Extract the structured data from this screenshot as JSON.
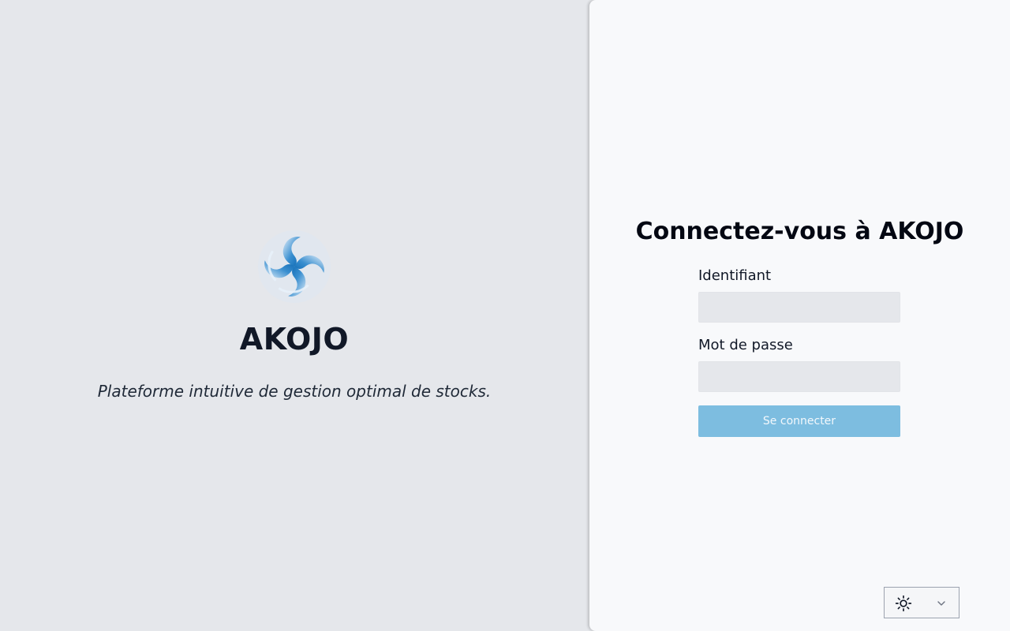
{
  "brand": {
    "name": "AKOJO",
    "tagline": "Plateforme intuitive de gestion optimal de stocks.",
    "logo_icon": "swirl-logo-icon",
    "logo_color": "#0e6fb8"
  },
  "login": {
    "title": "Connectez-vous à AKOJO",
    "username_label": "Identifiant",
    "username_value": "",
    "password_label": "Mot de passe",
    "password_value": "",
    "submit_label": "Se connecter",
    "submit_color": "#7dbde0"
  },
  "theme_switcher": {
    "icon": "sun-icon",
    "dropdown_icon": "chevron-down-icon"
  }
}
